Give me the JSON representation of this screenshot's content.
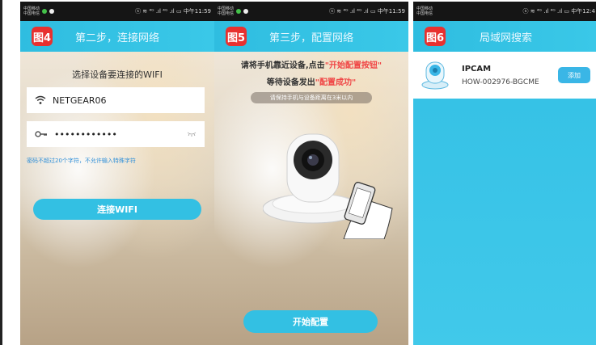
{
  "colors": {
    "accent": "#33c0e3",
    "badge": "#e8312f",
    "highlight": "#f04545",
    "statusbar": "#151515"
  },
  "screens": [
    {
      "status": {
        "carrier": "中国移动\n中国电信",
        "icons": "ⓢ ≋ ⁴ᴳ .ıl ⁴ᴳ .ıl ▭",
        "time": "中午11:59"
      },
      "badge": "图4",
      "title": "第二步，连接网络",
      "heading": "选择设备要连接的WIFI",
      "wifi_name": "NETGEAR06",
      "password": "••••••••••••",
      "hint": "密码不超过20个字符，不允许输入特殊字符",
      "button": "连接WIFI",
      "icons": {
        "wifi": "wifi-icon",
        "key": "key-icon",
        "eye": "eye-closed-icon"
      }
    },
    {
      "status": {
        "carrier": "中国移动\n中国电信",
        "icons": "ⓢ ≋ ⁴ᴳ .ıl ⁴ᴳ .ıl ▭",
        "time": "中午11:59"
      },
      "badge": "图5",
      "title": "第三步，配置网络",
      "line1_pre": "请将手机靠近设备,点击",
      "line1_red": "\"开始配置按钮\"",
      "line2_pre": "等待设备发出",
      "line2_red": "\"配置成功\"",
      "pill": "请保持手机与设备距离在3米以内",
      "button": "开始配置"
    },
    {
      "status": {
        "carrier": "中国移动\n中国电信",
        "icons": "ⓢ ≋ ⁴ᴳ .ıl ⁴ᴳ .ıl ▭",
        "time": "中午12:4"
      },
      "badge": "图6",
      "title": "局域网搜索",
      "device": {
        "name": "IPCAM",
        "id": "HOW-002976-BGCME",
        "add": "添加"
      }
    }
  ]
}
